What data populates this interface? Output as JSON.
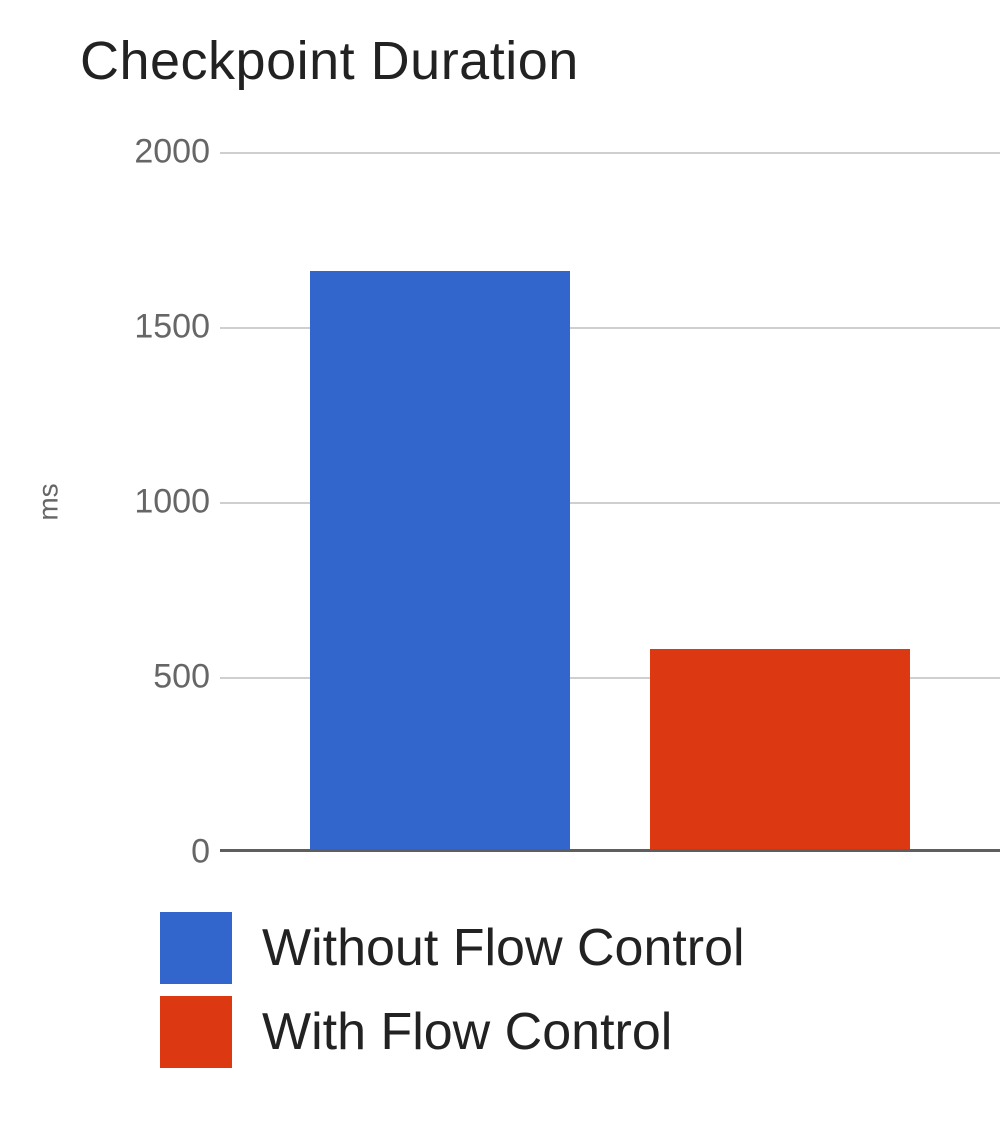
{
  "chart_data": {
    "type": "bar",
    "title": "Checkpoint Duration",
    "xlabel": "",
    "ylabel": "ms",
    "ylim": [
      0,
      2000
    ],
    "yticks": [
      0,
      500,
      1000,
      1500,
      2000
    ],
    "categories": [
      "Without Flow Control",
      "With Flow Control"
    ],
    "values": [
      1660,
      580
    ],
    "colors": [
      "#3366cc",
      "#dc3912"
    ],
    "grid": true,
    "legend_position": "bottom"
  },
  "legend": [
    {
      "label": "Without Flow Control",
      "color": "#3366cc"
    },
    {
      "label": "With Flow Control",
      "color": "#dc3912"
    }
  ]
}
